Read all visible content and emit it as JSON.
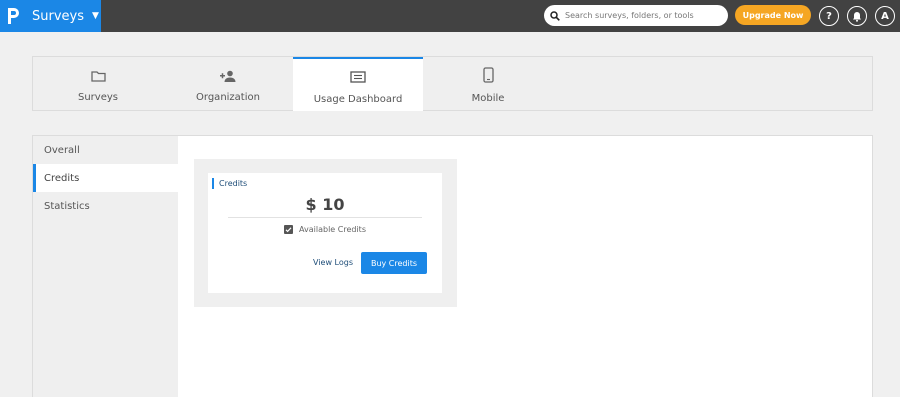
{
  "header": {
    "app_name": "Surveys",
    "search_placeholder": "Search surveys, folders, or tools",
    "upgrade_label": "Upgrade Now",
    "help_label": "?",
    "avatar_initial": "A"
  },
  "tabs": [
    {
      "label": "Surveys",
      "icon": "folder-icon"
    },
    {
      "label": "Organization",
      "icon": "people-icon"
    },
    {
      "label": "Usage Dashboard",
      "icon": "dashboard-icon",
      "active": true
    },
    {
      "label": "Mobile",
      "icon": "mobile-icon"
    }
  ],
  "sidebar": {
    "items": [
      {
        "label": "Overall"
      },
      {
        "label": "Credits",
        "active": true
      },
      {
        "label": "Statistics"
      }
    ]
  },
  "credits_card": {
    "title": "Credits",
    "amount": "$ 10",
    "available_label": "Available Credits",
    "view_logs_label": "View Logs",
    "buy_label": "Buy Credits"
  },
  "colors": {
    "accent": "#1b87e6",
    "topbar": "#424242",
    "upgrade": "#f5a623"
  }
}
